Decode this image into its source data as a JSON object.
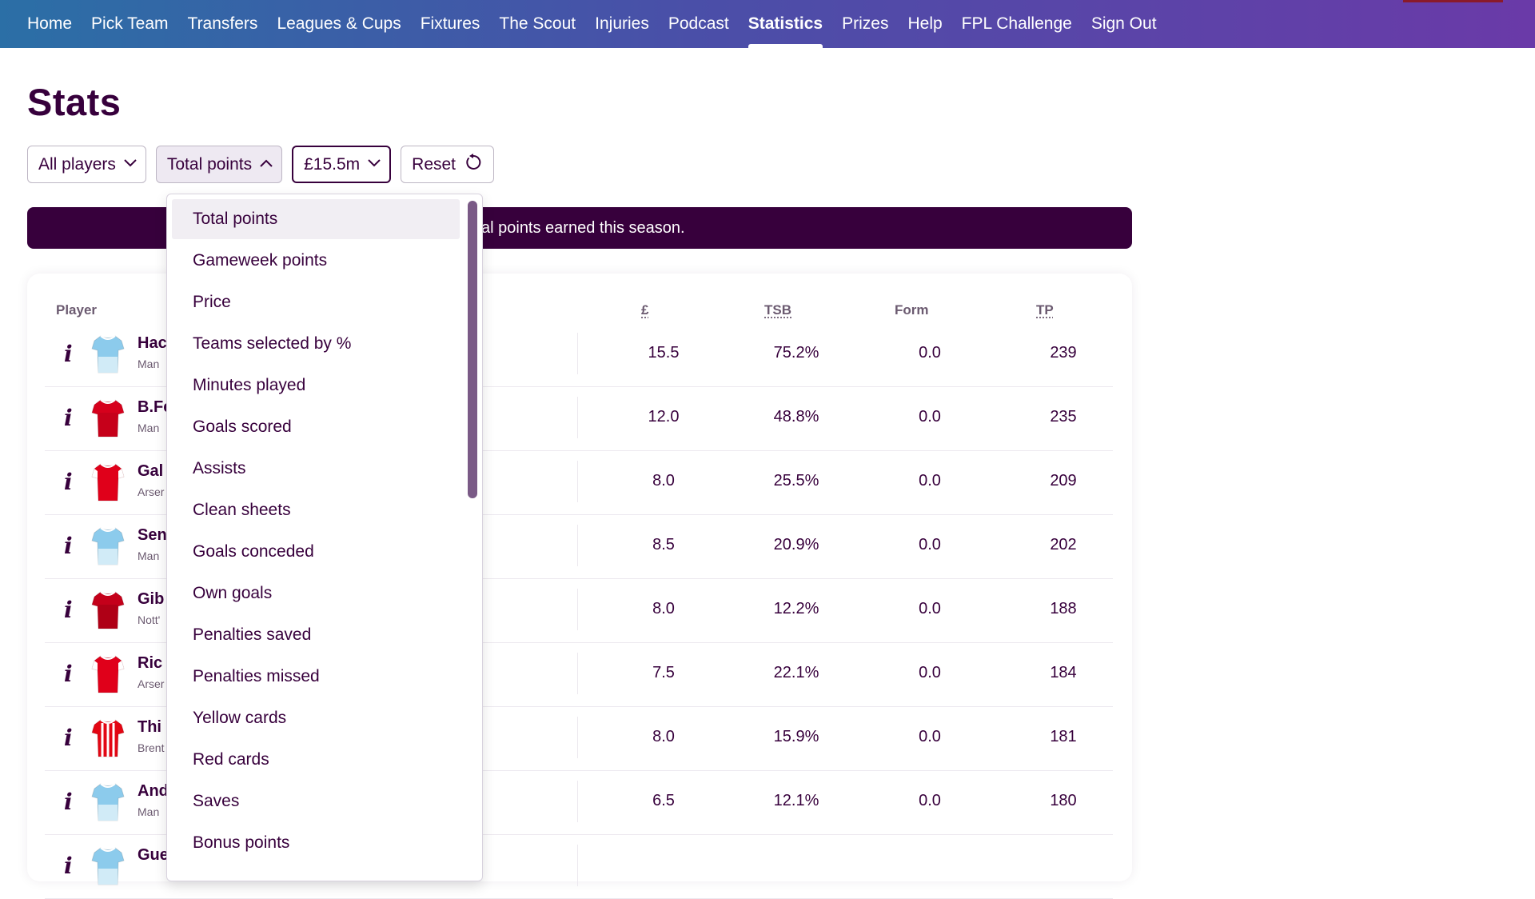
{
  "nav": {
    "items": [
      "Home",
      "Pick Team",
      "Transfers",
      "Leagues & Cups",
      "Fixtures",
      "The Scout",
      "Injuries",
      "Podcast",
      "Statistics",
      "Prizes",
      "Help",
      "FPL Challenge",
      "Sign Out"
    ],
    "active": "Statistics"
  },
  "page": {
    "title": "Stats"
  },
  "filters": {
    "players": "All players",
    "sort": "Total points",
    "price": "£15.5m",
    "reset": "Reset"
  },
  "banner": {
    "text": "al points earned this season."
  },
  "table": {
    "headers": {
      "player": "Player",
      "price": "£",
      "tsb": "TSB",
      "form": "Form",
      "tp": "TP"
    },
    "rows": [
      {
        "name": "Hac",
        "team": "Man",
        "kit": "sky",
        "price": "15.5",
        "tsb": "75.2%",
        "form": "0.0",
        "tp": "239"
      },
      {
        "name": "B.Fe",
        "team": "Man",
        "kit": "red",
        "price": "12.0",
        "tsb": "48.8%",
        "form": "0.0",
        "tp": "235"
      },
      {
        "name": "Gal",
        "team": "Arser",
        "kit": "arsenal",
        "price": "8.0",
        "tsb": "25.5%",
        "form": "0.0",
        "tp": "209"
      },
      {
        "name": "Sen",
        "team": "Man",
        "kit": "sky",
        "price": "8.5",
        "tsb": "20.9%",
        "form": "0.0",
        "tp": "202"
      },
      {
        "name": "Gib",
        "team": "Nott'",
        "kit": "forest",
        "price": "8.0",
        "tsb": "12.2%",
        "form": "0.0",
        "tp": "188"
      },
      {
        "name": "Ric",
        "team": "Arser",
        "kit": "arsenal",
        "price": "7.5",
        "tsb": "22.1%",
        "form": "0.0",
        "tp": "184"
      },
      {
        "name": "Thi",
        "team": "Brent",
        "kit": "stripes",
        "price": "8.0",
        "tsb": "15.9%",
        "form": "0.0",
        "tp": "181"
      },
      {
        "name": "And",
        "team": "Man",
        "kit": "sky",
        "price": "6.5",
        "tsb": "12.1%",
        "form": "0.0",
        "tp": "180"
      },
      {
        "name": "Gue",
        "team": "",
        "kit": "sky",
        "price": "",
        "tsb": "",
        "form": "",
        "tp": ""
      }
    ]
  },
  "dropdown": {
    "selected": "Total points",
    "options": [
      "Total points",
      "Gameweek points",
      "Price",
      "Teams selected by %",
      "Minutes played",
      "Goals scored",
      "Assists",
      "Clean sheets",
      "Goals conceded",
      "Own goals",
      "Penalties saved",
      "Penalties missed",
      "Yellow cards",
      "Red cards",
      "Saves",
      "Bonus points"
    ]
  },
  "info_glyph": "i"
}
